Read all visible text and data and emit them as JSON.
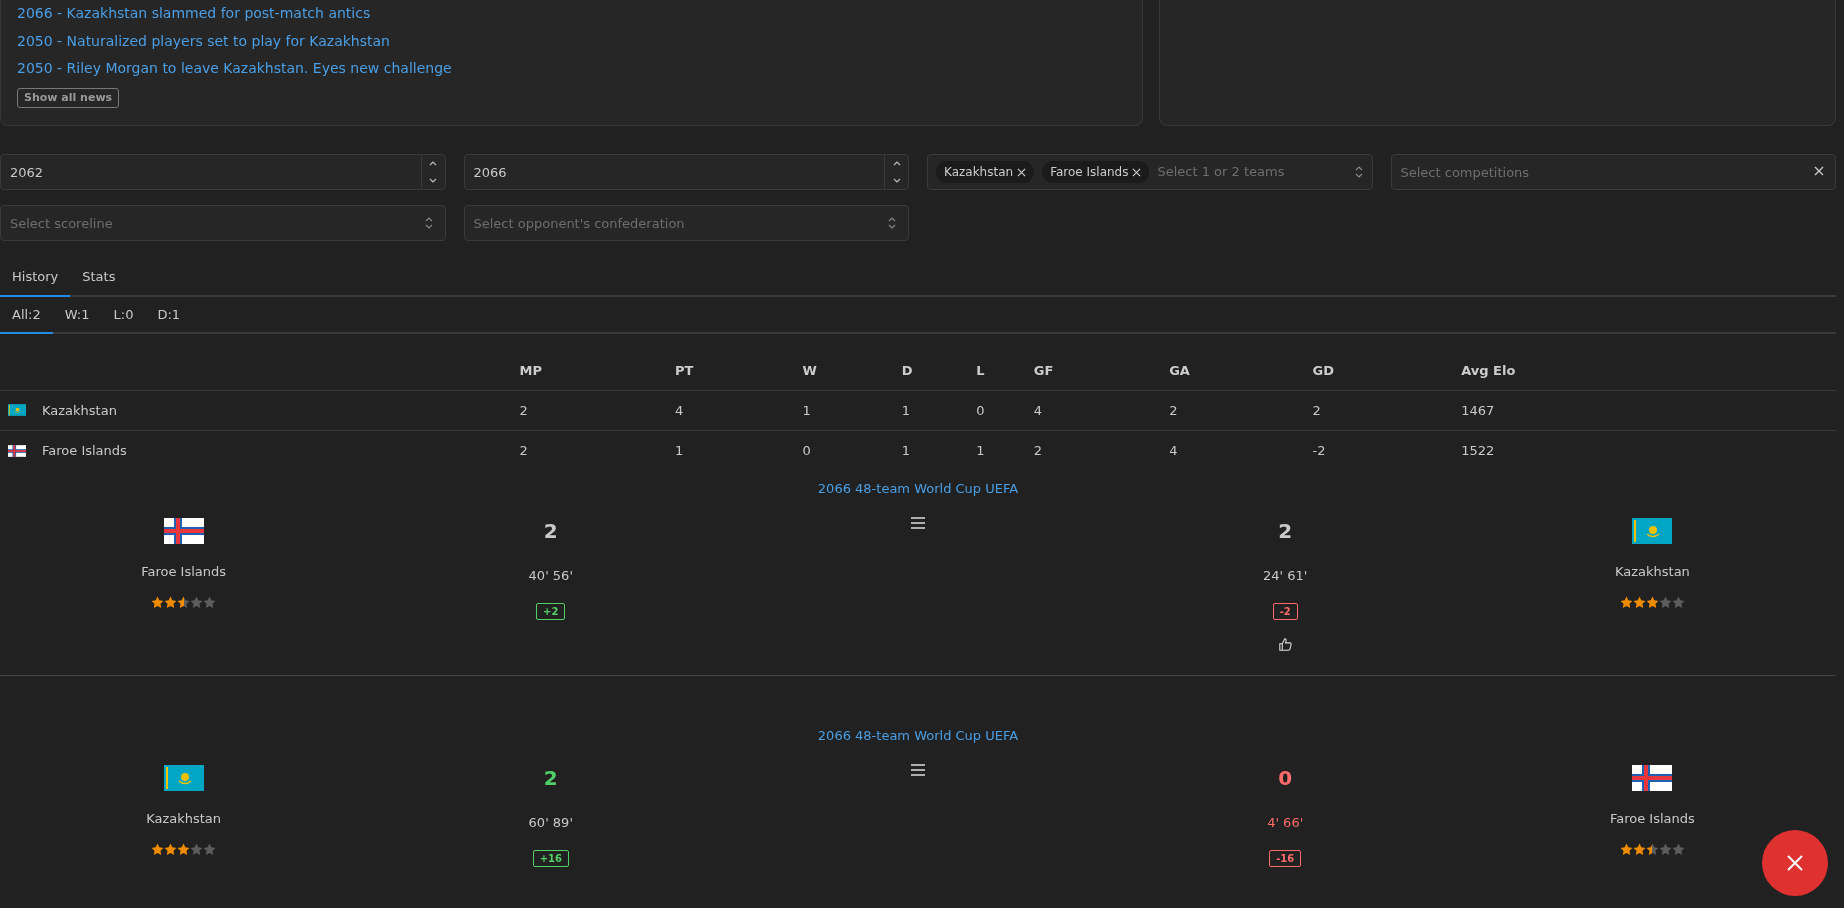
{
  "news": {
    "items": [
      "2066 - Kazakhstan slammed for post-match antics",
      "2050 - Naturalized players set to play for Kazakhstan",
      "2050 - Riley Morgan to leave Kazakhstan. Eyes new challenge"
    ],
    "button": "Show all news"
  },
  "filters": {
    "year_from": {
      "value": "2062"
    },
    "year_to": {
      "value": "2066"
    },
    "teams": {
      "chips": [
        "Kazakhstan",
        "Faroe Islands"
      ],
      "placeholder": "Select 1 or 2 teams"
    },
    "competitions": {
      "placeholder": "Select competitions"
    },
    "scoreline": {
      "placeholder": "Select scoreline"
    },
    "confederation": {
      "placeholder": "Select opponent's confederation"
    }
  },
  "tabs": [
    {
      "label": "History",
      "selected": true
    },
    {
      "label": "Stats",
      "selected": false
    }
  ],
  "subtabs": [
    {
      "label": "All:2",
      "selected": true
    },
    {
      "label": "W:1",
      "selected": false
    },
    {
      "label": "L:0",
      "selected": false
    },
    {
      "label": "D:1",
      "selected": false
    }
  ],
  "table": {
    "columns": [
      "MP",
      "PT",
      "W",
      "D",
      "L",
      "GF",
      "GA",
      "GD",
      "Avg Elo"
    ],
    "rows": [
      {
        "kind": "kazakhstan",
        "team": "Kazakhstan",
        "cells": [
          "2",
          "4",
          "1",
          "1",
          "0",
          "4",
          "2",
          "2",
          "1467"
        ]
      },
      {
        "kind": "faroe",
        "team": "Faroe Islands",
        "cells": [
          "2",
          "1",
          "0",
          "1",
          "1",
          "2",
          "4",
          "-2",
          "1522"
        ]
      }
    ]
  },
  "matches": [
    {
      "competition": "2066 48-team World Cup UEFA",
      "sides": [
        {
          "kind": "faroe",
          "team": "Faroe Islands",
          "stars": 2.5,
          "score": {
            "text": "2",
            "color": "#c9c9c9"
          },
          "minutes": {
            "text": "40' 56'",
            "color": "#c9c9c9"
          },
          "elo": {
            "text": "+2",
            "color": "#51cf66"
          },
          "thumbs_up": false
        },
        {
          "kind": "kazakhstan",
          "team": "Kazakhstan",
          "stars": 3,
          "score": {
            "text": "2",
            "color": "#c9c9c9"
          },
          "minutes": {
            "text": "24' 61'",
            "color": "#c9c9c9"
          },
          "elo": {
            "text": "-2",
            "color": "#ff6b6b"
          },
          "thumbs_up": true
        }
      ]
    },
    {
      "competition": "2066 48-team World Cup UEFA",
      "sides": [
        {
          "kind": "kazakhstan",
          "team": "Kazakhstan",
          "stars": 3,
          "score": {
            "text": "2",
            "color": "#51cf66"
          },
          "minutes": {
            "text": "60' 89'",
            "color": "#c9c9c9"
          },
          "elo": {
            "text": "+16",
            "color": "#51cf66"
          },
          "thumbs_up": false
        },
        {
          "kind": "faroe",
          "team": "Faroe Islands",
          "stars": 2.5,
          "score": {
            "text": "0",
            "color": "#ff6b6b"
          },
          "minutes": {
            "text": "4' 66'",
            "color": "#ff6b6b"
          },
          "elo": {
            "text": "-16",
            "color": "#ff6b6b"
          },
          "thumbs_up": false
        }
      ]
    }
  ]
}
